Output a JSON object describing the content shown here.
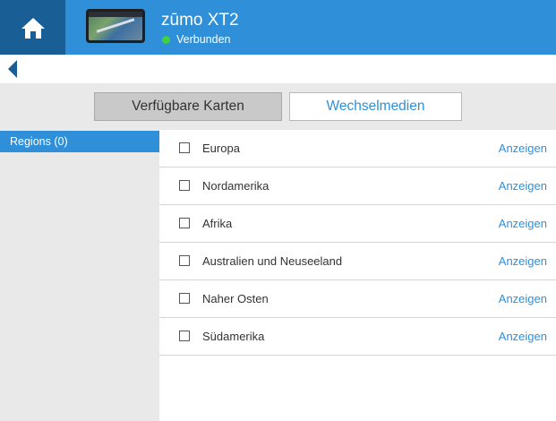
{
  "header": {
    "home_icon": "home-icon",
    "device_name": "zūmo XT2",
    "status": "Verbunden",
    "status_color": "#3fd23f",
    "accent_color": "#2f8fd8",
    "home_bg_color": "#1a5e96"
  },
  "nav": {
    "back_icon": "chevron-left-icon"
  },
  "tabs": [
    {
      "label": "Verfügbare Karten",
      "active": true
    },
    {
      "label": "Wechselmedien",
      "active": false
    }
  ],
  "sidebar": {
    "items": [
      {
        "label": "Regions (0)",
        "selected": true
      }
    ]
  },
  "regions": {
    "items": [
      {
        "name": "Europa",
        "action": "Anzeigen",
        "checked": false
      },
      {
        "name": "Nordamerika",
        "action": "Anzeigen",
        "checked": false
      },
      {
        "name": "Afrika",
        "action": "Anzeigen",
        "checked": false
      },
      {
        "name": "Australien und Neuseeland",
        "action": "Anzeigen",
        "checked": false
      },
      {
        "name": "Naher Osten",
        "action": "Anzeigen",
        "checked": false
      },
      {
        "name": "Südamerika",
        "action": "Anzeigen",
        "checked": false
      }
    ]
  }
}
